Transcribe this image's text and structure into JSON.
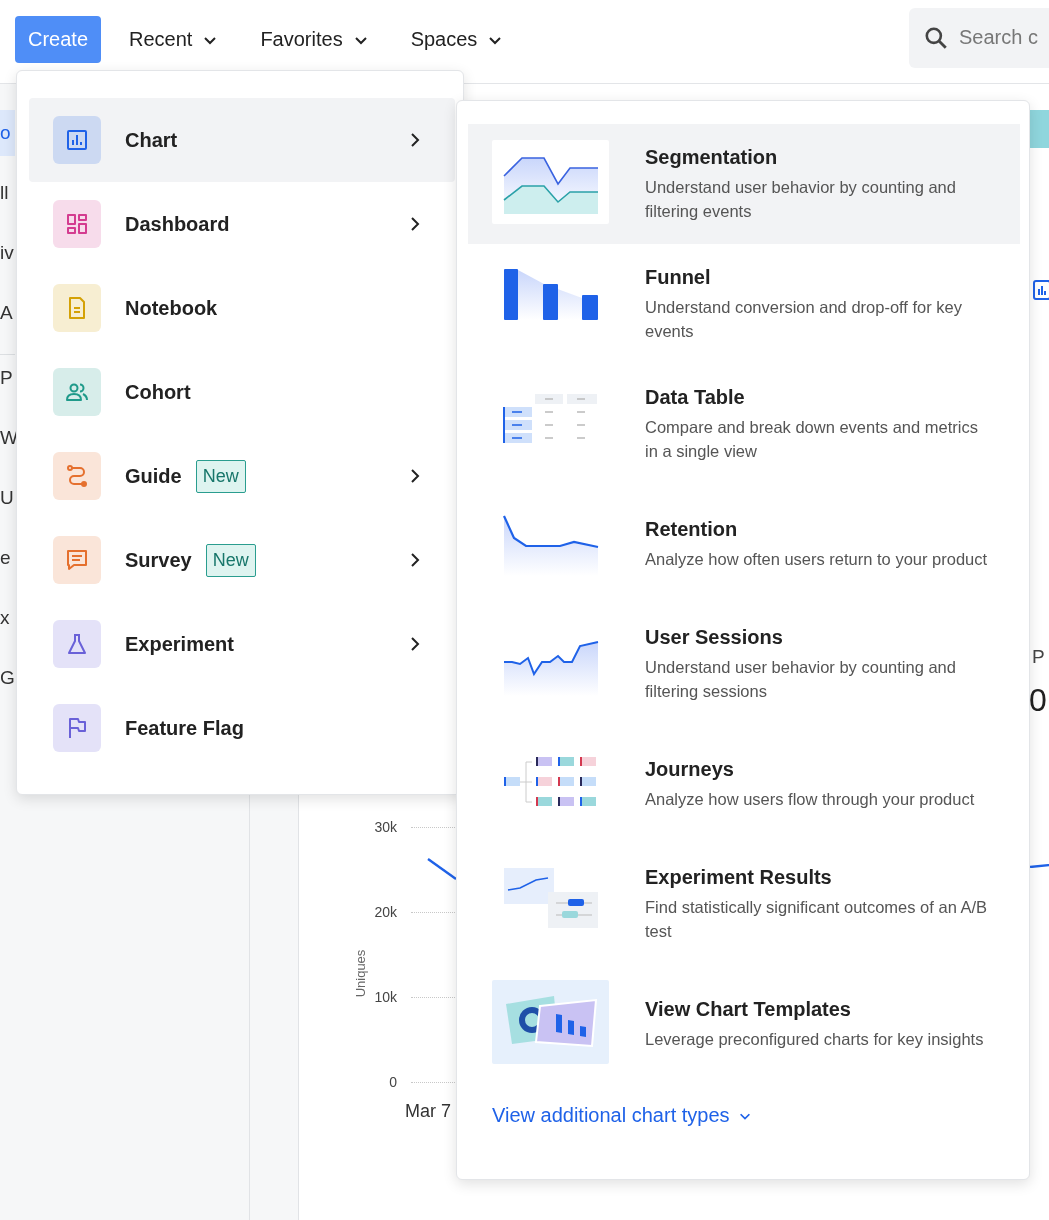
{
  "top_bar": {
    "create_button": "Create",
    "nav": [
      {
        "label": "Recent"
      },
      {
        "label": "Favorites"
      },
      {
        "label": "Spaces"
      }
    ],
    "search": {
      "placeholder": "Search c"
    }
  },
  "sidebar": {
    "items": [
      {
        "label": "o",
        "selected": true
      },
      {
        "label": "ll",
        "selected": false
      },
      {
        "label": "iv",
        "selected": false
      },
      {
        "label": "A",
        "selected": false
      },
      {
        "label": "P",
        "selected": false
      },
      {
        "label": "W",
        "selected": false
      },
      {
        "label": "U",
        "selected": false
      },
      {
        "label": "e",
        "selected": false
      },
      {
        "label": "x",
        "selected": false
      },
      {
        "label": "G",
        "selected": false
      }
    ]
  },
  "background_chart": {
    "ylabel": "Uniques",
    "yticks": [
      "30k",
      "20k",
      "10k",
      "0"
    ],
    "xticks": [
      "Mar 7"
    ]
  },
  "background_right": {
    "label": "P",
    "value": "0"
  },
  "create_menu": {
    "items": [
      {
        "label": "Chart",
        "kind": "chart",
        "color": "#1f62e8",
        "selected": true,
        "submenu": true
      },
      {
        "label": "Dashboard",
        "kind": "dashboard",
        "color": "#d43c90",
        "selected": false,
        "submenu": true
      },
      {
        "label": "Notebook",
        "kind": "notebook",
        "color": "#d4a106",
        "selected": false,
        "submenu": false
      },
      {
        "label": "Cohort",
        "kind": "cohort",
        "color": "#1f9a8a",
        "selected": false,
        "submenu": false
      },
      {
        "label": "Guide",
        "kind": "guide",
        "color": "#e5702e",
        "selected": false,
        "submenu": true,
        "badge": "New"
      },
      {
        "label": "Survey",
        "kind": "survey",
        "color": "#e5702e",
        "selected": false,
        "submenu": true,
        "badge": "New"
      },
      {
        "label": "Experiment",
        "kind": "experiment",
        "color": "#6a61d8",
        "selected": false,
        "submenu": true
      },
      {
        "label": "Feature Flag",
        "kind": "flag",
        "color": "#6a61d8",
        "selected": false,
        "submenu": false
      }
    ]
  },
  "chart_menu": {
    "items": [
      {
        "title": "Segmentation",
        "description": "Understand user behavior by counting and filtering events",
        "kind": "segmentation",
        "selected": true
      },
      {
        "title": "Funnel",
        "description": "Understand conversion and drop-off for key events",
        "kind": "funnel",
        "selected": false
      },
      {
        "title": "Data Table",
        "description": "Compare and break down events and metrics in a single view",
        "kind": "table",
        "selected": false
      },
      {
        "title": "Retention",
        "description": "Analyze how often users return to your product",
        "kind": "retention",
        "selected": false
      },
      {
        "title": "User Sessions",
        "description": "Understand user behavior by counting and filtering sessions",
        "kind": "sessions",
        "selected": false
      },
      {
        "title": "Journeys",
        "description": "Analyze how users flow through your product",
        "kind": "journeys",
        "selected": false
      },
      {
        "title": "Experiment Results",
        "description": "Find statistically significant outcomes of an A/B test",
        "kind": "experiment",
        "selected": false
      },
      {
        "title": "View Chart Templates",
        "description": "Leverage preconfigured charts for key insights",
        "kind": "templates",
        "selected": false
      }
    ],
    "more_link": "View additional chart types"
  }
}
